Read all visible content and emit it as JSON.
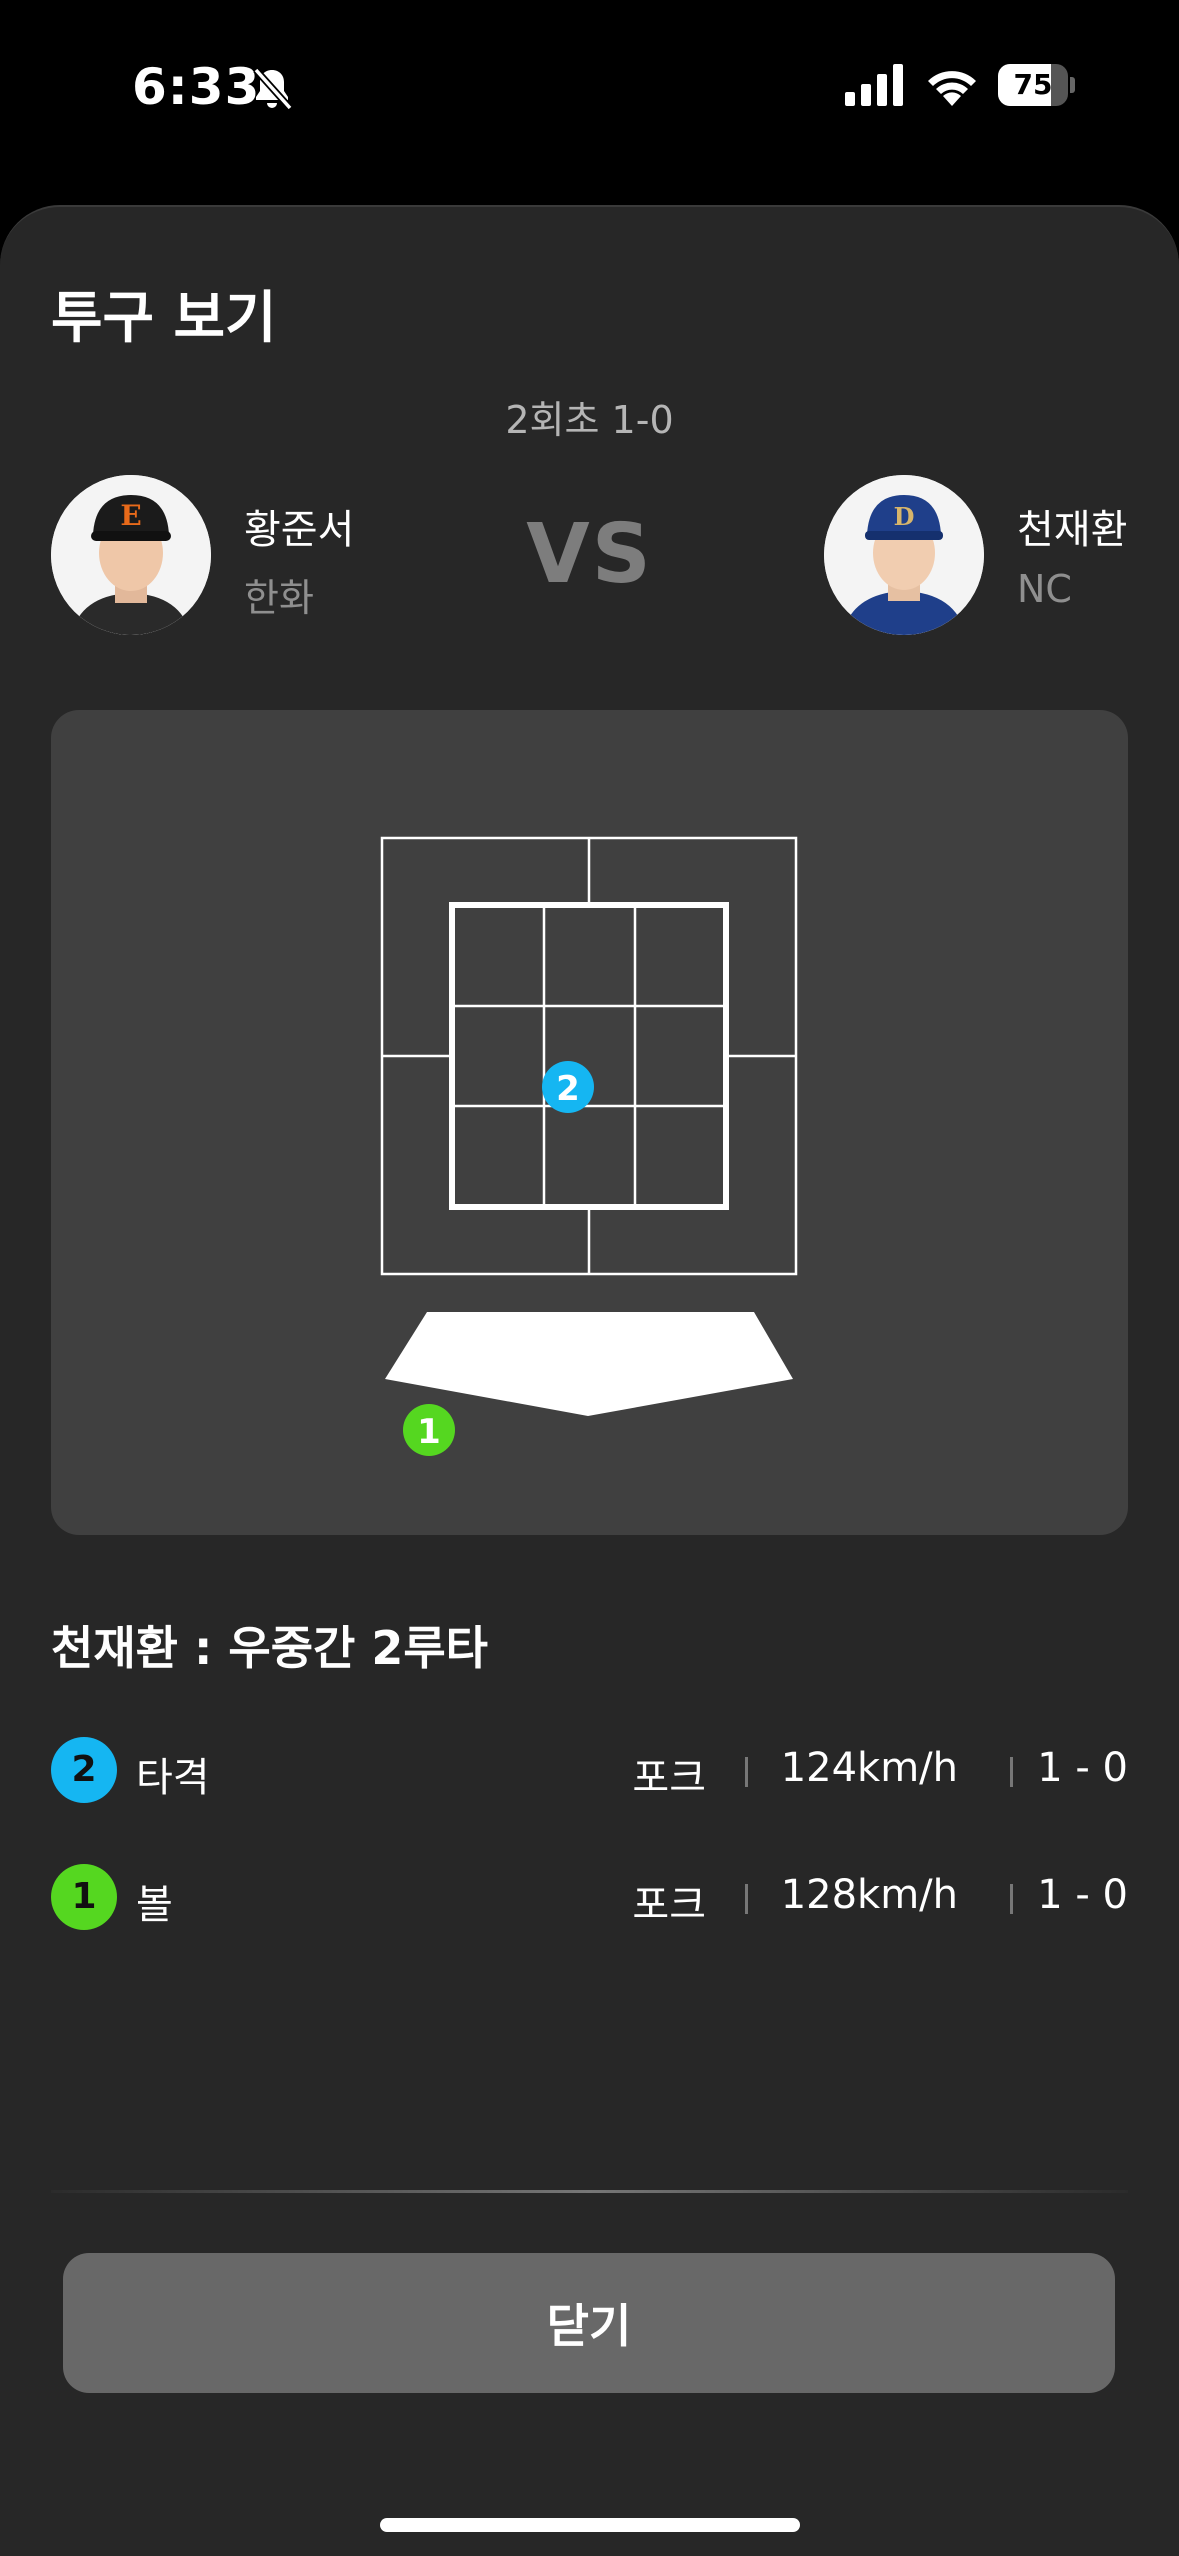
{
  "status_bar": {
    "time": "6:33",
    "battery": "75",
    "battery_level": 0.75,
    "icons": [
      "bell-slash-icon",
      "cellular-signal-icon",
      "wifi-icon",
      "battery-icon"
    ]
  },
  "sheet": {
    "title": "투구 보기",
    "inning": "2회초 1-0",
    "vs": "VS"
  },
  "pitcher": {
    "name": "황준서",
    "team": "한화"
  },
  "batter": {
    "name": "천재환",
    "team": "NC"
  },
  "result_title": "천재환 : 우중간 2루타",
  "pitches": [
    {
      "number": "2",
      "result": "타격",
      "type": "포크",
      "speed": "124km/h",
      "count": "1 - 0",
      "color": "#15b6f2"
    },
    {
      "number": "1",
      "result": "볼",
      "type": "포크",
      "speed": "128km/h",
      "count": "1 - 0",
      "color": "#55d720"
    }
  ],
  "close_label": "닫기",
  "colors": {
    "background": "#000000",
    "sheet": "#272727",
    "card": "#404040",
    "button": "#686868",
    "hit": "#15b6f2",
    "ball": "#55d720"
  }
}
